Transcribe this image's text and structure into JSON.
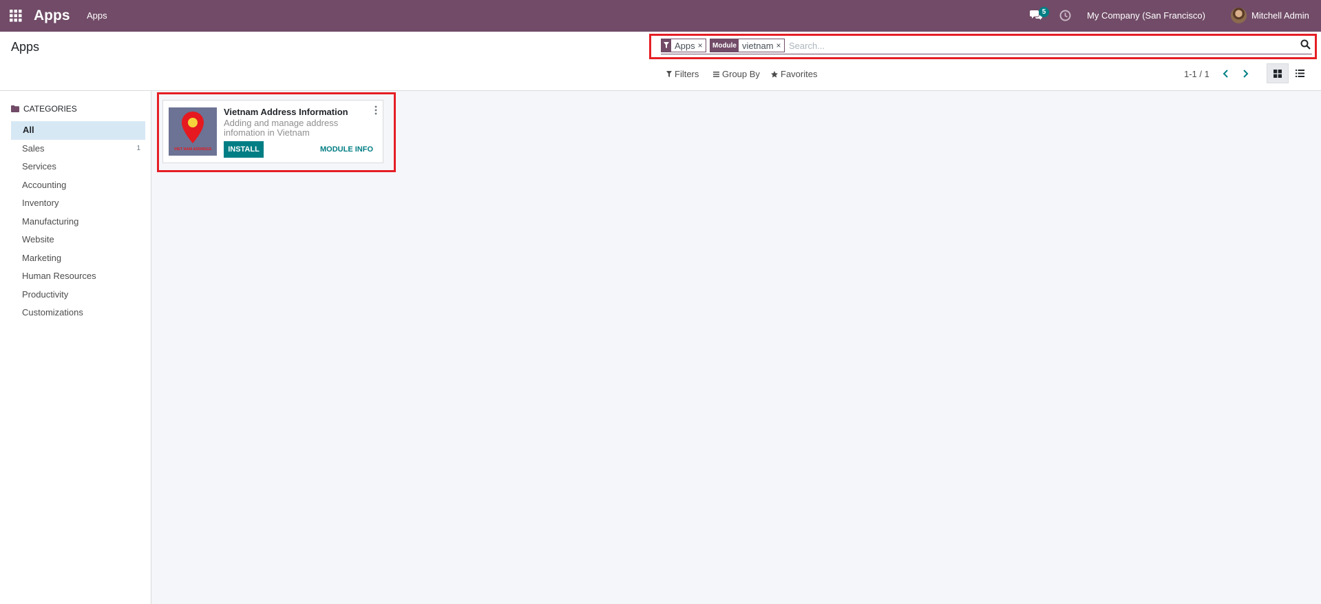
{
  "navbar": {
    "brand": "Apps",
    "menu_item": "Apps",
    "chat_count": "5",
    "company": "My Company (San Francisco)",
    "user_name": "Mitchell Admin",
    "bg_color": "#714b67"
  },
  "control_panel": {
    "title": "Apps",
    "facets": [
      {
        "icon": "filter-icon",
        "value": "Apps",
        "remove": "×"
      },
      {
        "label": "Module",
        "value": "vietnam",
        "remove": "×"
      }
    ],
    "search_placeholder": "Search...",
    "filters_label": "Filters",
    "group_by_label": "Group By",
    "favorites_label": "Favorites",
    "pager": "1-1 / 1"
  },
  "sidebar": {
    "header": "CATEGORIES",
    "items": [
      {
        "label": "All",
        "count": "",
        "active": true
      },
      {
        "label": "Sales",
        "count": "1"
      },
      {
        "label": "Services",
        "count": ""
      },
      {
        "label": "Accounting",
        "count": ""
      },
      {
        "label": "Inventory",
        "count": ""
      },
      {
        "label": "Manufacturing",
        "count": ""
      },
      {
        "label": "Website",
        "count": ""
      },
      {
        "label": "Marketing",
        "count": ""
      },
      {
        "label": "Human Resources",
        "count": ""
      },
      {
        "label": "Productivity",
        "count": ""
      },
      {
        "label": "Customizations",
        "count": ""
      }
    ]
  },
  "card": {
    "name": "Vietnam Address Information",
    "summary": "Adding and manage address infomation in Vietnam",
    "install_label": "INSTALL",
    "info_label": "MODULE INFO",
    "image_text": "VIET NAM ADDRESS",
    "accent_color": "#017e84"
  },
  "highlight_color": "#e51e25"
}
